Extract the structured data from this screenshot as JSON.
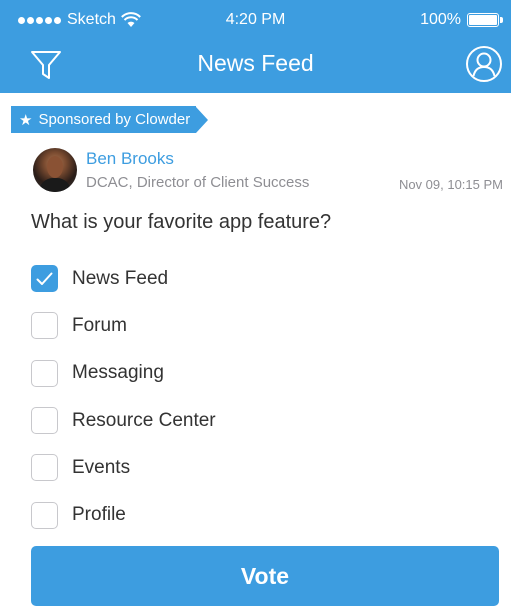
{
  "status_bar": {
    "carrier": "Sketch",
    "time": "4:20 PM",
    "battery": "100%",
    "battery_level": 1.0
  },
  "nav": {
    "title": "News Feed",
    "left_icon": "filter-icon",
    "right_icon": "profile-icon"
  },
  "sponsor": {
    "label": "Sponsored by Clowder",
    "icon": "star-icon"
  },
  "post": {
    "author_name": "Ben Brooks",
    "author_role": "DCAC, Director of Client Success",
    "timestamp": "Nov 09, 10:15 PM"
  },
  "poll": {
    "question": "What is your favorite app feature?",
    "options": [
      {
        "label": "News Feed",
        "checked": true
      },
      {
        "label": "Forum",
        "checked": false
      },
      {
        "label": "Messaging",
        "checked": false
      },
      {
        "label": "Resource Center",
        "checked": false
      },
      {
        "label": "Events",
        "checked": false
      },
      {
        "label": "Profile",
        "checked": false
      }
    ],
    "vote_label": "Vote"
  },
  "colors": {
    "accent": "#3d9de0",
    "text": "#333333",
    "muted": "#8e8e93",
    "checkbox_border": "#c8c8cc"
  }
}
